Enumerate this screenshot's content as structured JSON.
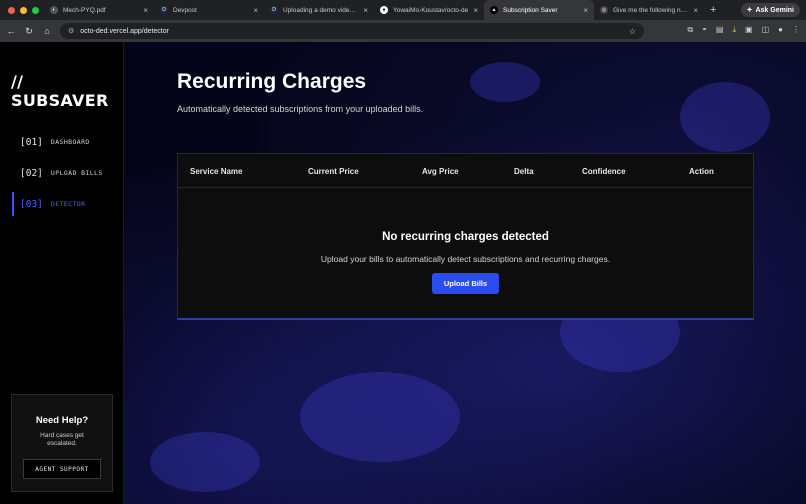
{
  "browser": {
    "tabs": [
      {
        "label": "Mech-PYQ.pdf",
        "icon": "pdf-icon",
        "active": false
      },
      {
        "label": "Devpost",
        "icon": "devpost-icon",
        "active": false
      },
      {
        "label": "Uploading a demo video - D",
        "icon": "devpost-icon",
        "active": false
      },
      {
        "label": "YowaiMo-Koustav/octo-de",
        "icon": "github-icon",
        "active": false
      },
      {
        "label": "Subscription Saver",
        "icon": "vercel-icon",
        "active": true
      },
      {
        "label": "Give me the following need:",
        "icon": "chat-icon",
        "active": false
      }
    ],
    "ask_gemini": "Ask Gemini",
    "url": "octo-ded.vercel.app/detector"
  },
  "sidebar": {
    "logo": "// SUBSAVER",
    "items": [
      {
        "num": "[01]",
        "label": "DASHBOARD",
        "active": false
      },
      {
        "num": "[02]",
        "label": "UPLOAD BILLS",
        "active": false
      },
      {
        "num": "[03]",
        "label": "DETECTOR",
        "active": true
      }
    ],
    "help": {
      "title": "Need Help?",
      "text": "Hard cases get escalated.",
      "button": "AGENT SUPPORT"
    }
  },
  "main": {
    "title": "Recurring Charges",
    "subtitle": "Automatically detected subscriptions from your uploaded bills.",
    "table": {
      "columns": [
        "Service Name",
        "Current Price",
        "Avg Price",
        "Delta",
        "Confidence",
        "Action"
      ]
    },
    "empty": {
      "title": "No recurring charges detected",
      "text": "Upload your bills to automatically detect subscriptions and recurring charges.",
      "button": "Upload Bills"
    }
  },
  "colors": {
    "accent": "#2b4cf0",
    "active_nav": "#4a63ff"
  }
}
